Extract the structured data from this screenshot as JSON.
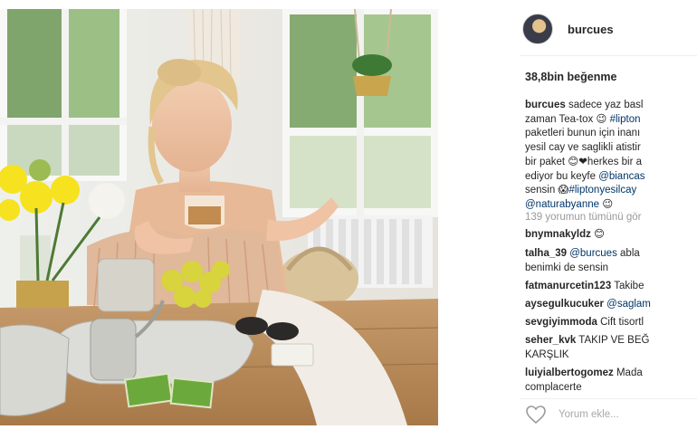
{
  "post": {
    "username": "burcues",
    "likes": "38,8bin beğenme",
    "caption": {
      "username": "burcues",
      "lines": [
        "sadece yaz basl",
        "zaman Tea-tox 😉 ",
        "paketleri bunun için inanı",
        "yesil cay ve saglikli atistir",
        "bir paket 😊❤herkes bir a",
        "ediyor bu keyfe ",
        "sensin 😱",
        ""
      ],
      "tags": {
        "lipton": "#lipton",
        "biancas": "@biancas",
        "liptonyesilcay": "#liptonyesilcay",
        "naturabyanne": "@naturabyanne"
      },
      "emoji_end": " 😉"
    },
    "view_comments": "139 yorumun tümünü gör",
    "comments": [
      {
        "user": "bnymnakyldz",
        "text": " 😊",
        "cont": ""
      },
      {
        "user": "talha_39",
        "mention": "@burcues",
        "text": " abla",
        "cont": "benimki de sensin"
      },
      {
        "user": "fatmanurcetin123",
        "text": " Takibe",
        "cont": ""
      },
      {
        "user": "aysegulkucuker",
        "mention": "@saglam",
        "text": "",
        "cont": ""
      },
      {
        "user": "sevgiyimmoda",
        "text": " Cift tisortl",
        "cont": ""
      },
      {
        "user": "seher_kvk",
        "text": " TAKIP VE BEĞ",
        "cont": "KARŞLIK"
      },
      {
        "user": "luiyialbertogomez",
        "text": " Mada",
        "cont": "complacerte"
      }
    ],
    "add_comment_placeholder": "Yorum ekle..."
  },
  "icons": {
    "like": "heart-icon"
  }
}
